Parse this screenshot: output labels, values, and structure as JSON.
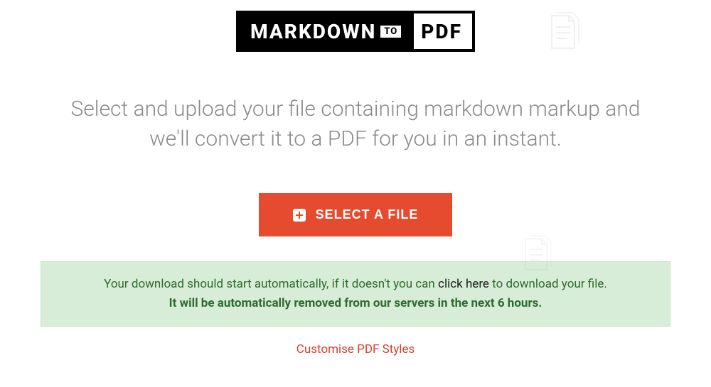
{
  "logo": {
    "left": "MARKDOWN",
    "middle": "TO",
    "right": "PDF"
  },
  "description": "Select and upload your file containing markdown markup and we'll convert it to a PDF for you in an instant.",
  "select_button_label": "SELECT A FILE",
  "alert": {
    "line1_pre": "Your download should start automatically, if it doesn't you can ",
    "line1_link": "click here",
    "line1_post": " to download your file.",
    "line2": "It will be automatically removed from our servers in the next 6 hours."
  },
  "customise_link": "Customise PDF Styles"
}
